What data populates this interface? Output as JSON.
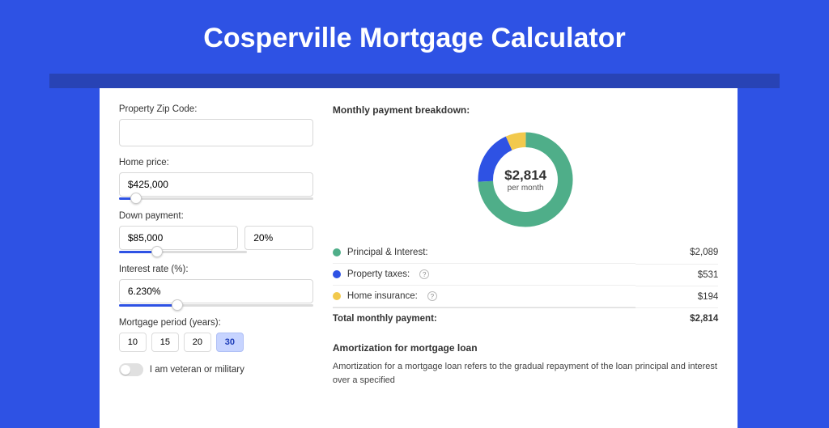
{
  "title": "Cosperville Mortgage Calculator",
  "colors": {
    "principal": "#4fae89",
    "taxes": "#2e52e4",
    "insurance": "#f2c94c"
  },
  "form": {
    "zip_label": "Property Zip Code:",
    "zip_value": "",
    "home_price_label": "Home price:",
    "home_price_value": "$425,000",
    "home_price_slider_pct": 9,
    "down_payment_label": "Down payment:",
    "down_payment_value": "$85,000",
    "down_payment_pct_value": "20%",
    "down_payment_slider_pct": 20,
    "interest_label": "Interest rate (%):",
    "interest_value": "6.230%",
    "interest_slider_pct": 30,
    "period_label": "Mortgage period (years):",
    "periods": [
      "10",
      "15",
      "20",
      "30"
    ],
    "period_selected": "30",
    "veteran_label": "I am veteran or military",
    "veteran_on": false
  },
  "breakdown": {
    "heading": "Monthly payment breakdown:",
    "center_amount": "$2,814",
    "center_sub": "per month",
    "rows": [
      {
        "dot": "principal",
        "label": "Principal & Interest:",
        "help": false,
        "value": "$2,089"
      },
      {
        "dot": "taxes",
        "label": "Property taxes:",
        "help": true,
        "value": "$531"
      },
      {
        "dot": "insurance",
        "label": "Home insurance:",
        "help": true,
        "value": "$194"
      }
    ],
    "total_label": "Total monthly payment:",
    "total_value": "$2,814"
  },
  "chart_data": {
    "type": "pie",
    "title": "Monthly payment breakdown",
    "series": [
      {
        "name": "Principal & Interest",
        "value": 2089,
        "color": "#4fae89"
      },
      {
        "name": "Property taxes",
        "value": 531,
        "color": "#2e52e4"
      },
      {
        "name": "Home insurance",
        "value": 194,
        "color": "#f2c94c"
      }
    ],
    "total": 2814,
    "center_label": "$2,814 per month"
  },
  "amort": {
    "heading": "Amortization for mortgage loan",
    "text": "Amortization for a mortgage loan refers to the gradual repayment of the loan principal and interest over a specified"
  }
}
